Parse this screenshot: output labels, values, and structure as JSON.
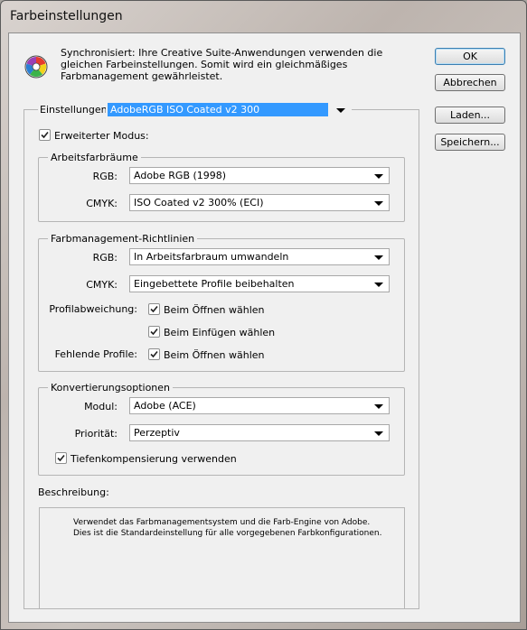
{
  "window": {
    "title": "Farbeinstellungen"
  },
  "info": {
    "text": "Synchronisiert: Ihre Creative Suite-Anwendungen verwenden die gleichen Farbeinstellungen. Somit wird ein gleichmäßiges Farbmanagement gewährleistet."
  },
  "buttons": {
    "ok": "OK",
    "cancel": "Abbrechen",
    "load": "Laden...",
    "save": "Speichern..."
  },
  "settings": {
    "label": "Einstellungen:",
    "value": "AdobeRGB ISO Coated v2 300"
  },
  "advanced": {
    "label": "Erweiterter Modus:",
    "checked": true
  },
  "workspaces": {
    "title": "Arbeitsfarbräume",
    "rgb_label": "RGB:",
    "rgb_value": "Adobe RGB (1998)",
    "cmyk_label": "CMYK:",
    "cmyk_value": "ISO Coated v2 300% (ECI)"
  },
  "policies": {
    "title": "Farbmanagement-Richtlinien",
    "rgb_label": "RGB:",
    "rgb_value": "In Arbeitsfarbraum umwandeln",
    "cmyk_label": "CMYK:",
    "cmyk_value": "Eingebettete Profile beibehalten",
    "mismatch_label": "Profilabweichung:",
    "mismatch_open": "Beim Öffnen wählen",
    "mismatch_paste": "Beim Einfügen wählen",
    "missing_label": "Fehlende Profile:",
    "missing_open": "Beim Öffnen wählen"
  },
  "conversion": {
    "title": "Konvertierungsoptionen",
    "module_label": "Modul:",
    "module_value": "Adobe (ACE)",
    "priority_label": "Priorität:",
    "priority_value": "Perzeptiv",
    "bpc_label": "Tiefenkompensierung verwenden"
  },
  "description": {
    "label": "Beschreibung:",
    "text": "Verwendet das Farbmanagementsystem und die Farb-Engine von Adobe. Dies ist die Standardeinstellung für alle vorgegebenen Farbkonfigurationen."
  }
}
